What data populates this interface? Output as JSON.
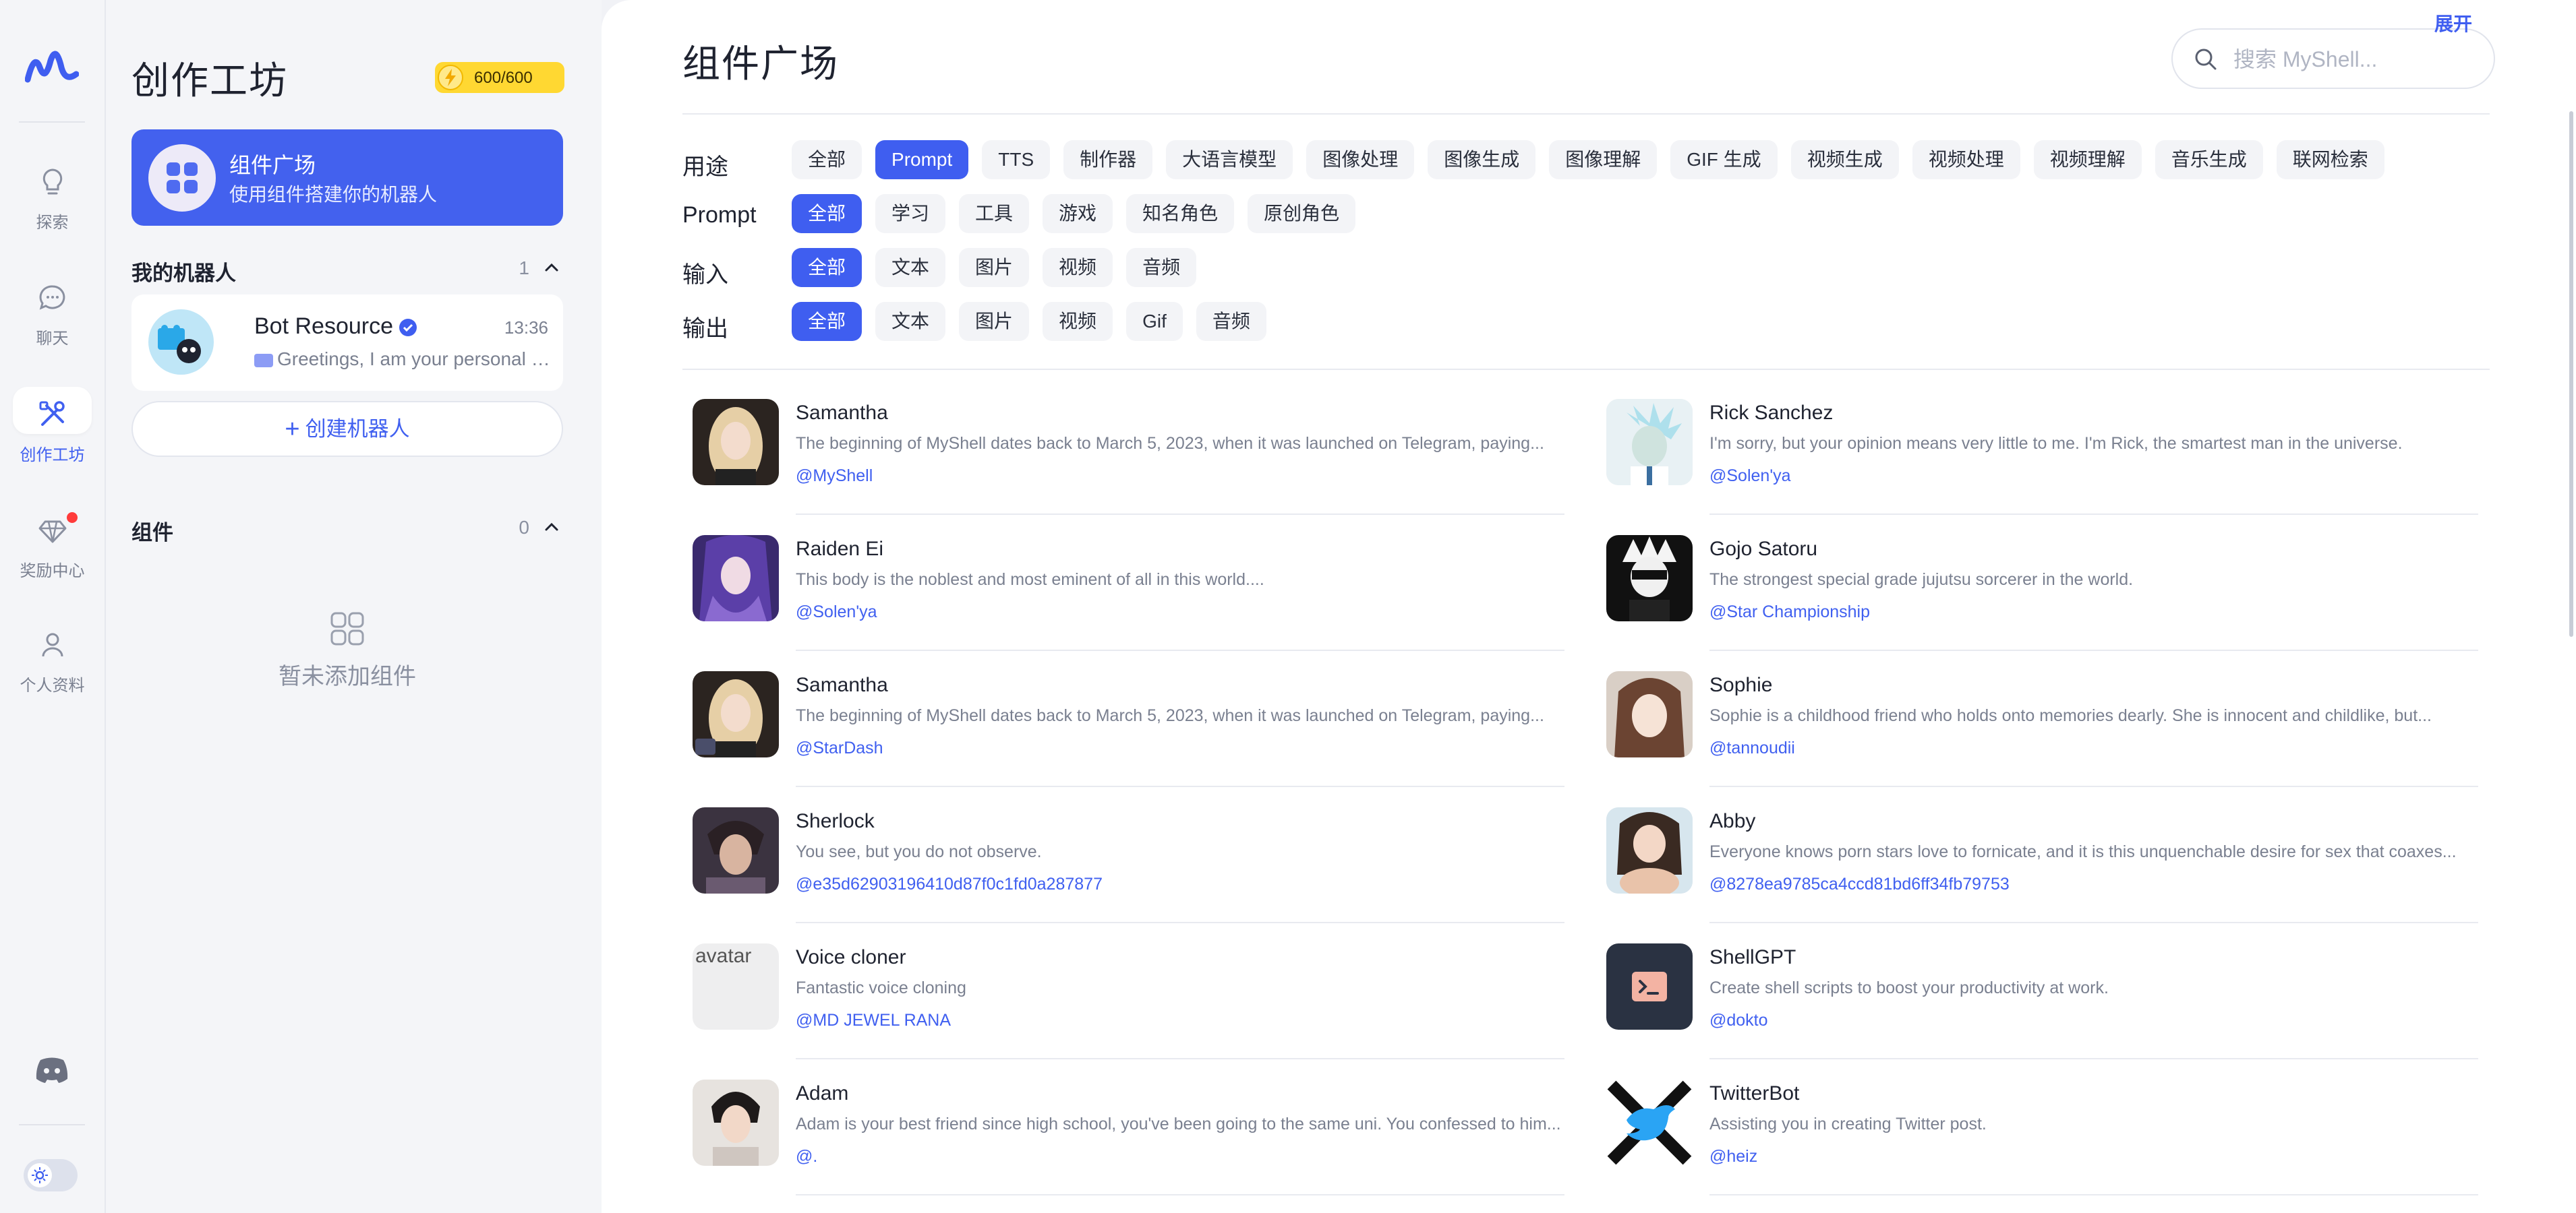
{
  "rail": {
    "items": [
      {
        "label": "探索",
        "icon": "lightbulb-icon"
      },
      {
        "label": "聊天",
        "icon": "chat-bubble-icon"
      },
      {
        "label": "创作工坊",
        "icon": "tools-icon",
        "active": true
      },
      {
        "label": "奖励中心",
        "icon": "diamond-icon",
        "badge_dot": true
      },
      {
        "label": "个人资料",
        "icon": "user-icon"
      }
    ]
  },
  "panel": {
    "title": "创作工坊",
    "credits": "600/600",
    "hero": {
      "title": "组件广场",
      "subtitle": "使用组件搭建你的机器人"
    },
    "my_bots": {
      "label": "我的机器人",
      "count": "1",
      "bots": [
        {
          "name": "Bot Resource",
          "time": "13:36",
          "message": "Greetings, I am your personal b..."
        }
      ]
    },
    "create_button": "创建机器人",
    "components": {
      "label": "组件",
      "count": "0",
      "empty_text": "暂未添加组件"
    }
  },
  "main": {
    "title": "组件广场",
    "search_placeholder": "搜索 MyShell...",
    "expand_label": "展开",
    "filters": [
      {
        "label": "用途",
        "chips": [
          "全部",
          "Prompt",
          "TTS",
          "制作器",
          "大语言模型",
          "图像处理",
          "图像生成",
          "图像理解",
          "GIF 生成",
          "视频生成",
          "视频处理",
          "视频理解",
          "音乐生成",
          "联网检索"
        ],
        "active": 1
      },
      {
        "label": "Prompt",
        "chips": [
          "全部",
          "学习",
          "工具",
          "游戏",
          "知名角色",
          "原创角色"
        ],
        "active": 0
      },
      {
        "label": "输入",
        "chips": [
          "全部",
          "文本",
          "图片",
          "视频",
          "音频"
        ],
        "active": 0
      },
      {
        "label": "输出",
        "chips": [
          "全部",
          "文本",
          "图片",
          "视频",
          "Gif",
          "音频"
        ],
        "active": 0
      }
    ],
    "cards": [
      {
        "title": "Samantha",
        "desc": "The beginning of MyShell dates back to March 5, 2023, when it was launched on Telegram, paying...",
        "author": "@MyShell"
      },
      {
        "title": "Rick Sanchez",
        "desc": "I'm sorry, but your opinion means very little to me. I'm Rick, the smartest man in the universe.",
        "author": "@Solen'ya"
      },
      {
        "title": "Raiden Ei",
        "desc": "This body is the noblest and most eminent of all in this world....",
        "author": "@Solen'ya"
      },
      {
        "title": "Gojo Satoru",
        "desc": "The strongest special grade jujutsu sorcerer in the world.",
        "author": "@Star Championship"
      },
      {
        "title": "Samantha",
        "desc": "The beginning of MyShell dates back to March 5, 2023, when it was launched on Telegram, paying...",
        "author": "@StarDash"
      },
      {
        "title": "Sophie",
        "desc": "Sophie is a childhood friend who holds onto memories dearly. She is innocent and childlike, but...",
        "author": "@tannoudii"
      },
      {
        "title": "Sherlock",
        "desc": "You see, but you do not observe.",
        "author": "@e35d62903196410d87f0c1fd0a287877"
      },
      {
        "title": "Abby",
        "desc": "Everyone knows porn stars love to fornicate, and it is this unquenchable desire for sex that coaxes...",
        "author": "@8278ea9785ca4ccd81bd6ff34fb79753"
      },
      {
        "title": "Voice cloner",
        "desc": "Fantastic voice cloning",
        "author": "@MD JEWEL RANA",
        "avatar_alt": "avatar"
      },
      {
        "title": "ShellGPT",
        "desc": "Create shell scripts to boost your productivity at work.",
        "author": "@dokto"
      },
      {
        "title": "Adam",
        "desc": "Adam is your best friend since high school, you've been going to the same uni. You confessed to him...",
        "author": "@."
      },
      {
        "title": "TwitterBot",
        "desc": "Assisting you in creating Twitter post.",
        "author": "@heiz"
      }
    ]
  },
  "colors": {
    "accent": "#3f5ef0",
    "hero_bg": "#4361ee",
    "credit_bg": "#ffd832",
    "badge_dot": "#ff3b3b"
  }
}
